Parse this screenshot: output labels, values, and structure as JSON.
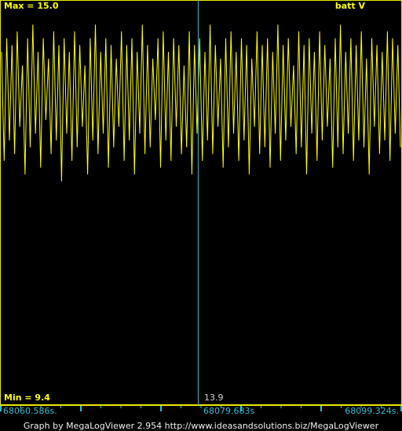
{
  "plot": {
    "max_label": "Max = 15.0",
    "min_label": "Min = 9.4",
    "series_label": "batt V",
    "cursor_value": "13.9"
  },
  "time_axis": {
    "left": "68060.586s.",
    "center": "68079.683s",
    "right": "68099.324s."
  },
  "footer": {
    "credit": "Graph by MegaLogViewer 2.954 http://www.ideasandsolutions.biz/MegaLogViewer"
  },
  "colors": {
    "background": "#000000",
    "trace": "#ffff00",
    "cursor": "#33bbd0",
    "axis_ticks": "#33bbd0",
    "frame": "#e8e800"
  },
  "chart_data": {
    "type": "line",
    "series": [
      {
        "name": "batt V",
        "values": [
          14.4,
          12.8,
          14.6,
          13.1,
          14.5,
          12.9,
          14.7,
          13.3,
          14.2,
          12.6,
          14.6,
          13.0,
          14.8,
          13.2,
          14.4,
          12.7,
          14.6,
          13.4,
          14.3,
          12.9,
          14.7,
          13.1,
          14.5,
          12.5,
          14.6,
          13.2,
          14.4,
          12.8,
          14.7,
          13.0,
          14.5,
          13.3,
          14.2,
          12.6,
          14.6,
          13.1,
          14.8,
          12.9,
          14.4,
          13.2,
          14.6,
          12.7,
          14.5,
          13.0,
          14.3,
          13.3,
          14.7,
          12.8,
          14.5,
          13.1,
          14.6,
          12.6,
          14.4,
          13.2,
          14.8,
          12.9,
          14.5,
          13.0,
          14.3,
          13.4,
          14.6,
          12.7,
          14.7,
          13.1,
          14.4,
          12.8,
          14.6,
          13.3,
          14.5,
          12.9,
          14.2,
          13.0,
          14.7,
          12.6,
          14.5,
          13.2,
          14.6,
          12.8,
          14.4,
          13.1,
          14.8,
          12.9,
          14.5,
          13.3,
          14.3,
          12.7,
          14.6,
          13.0,
          14.7,
          13.2,
          14.4,
          12.8,
          14.6,
          13.1,
          14.5,
          12.6,
          14.3,
          13.3,
          14.7,
          12.9,
          14.5,
          13.0,
          14.6,
          12.7,
          14.4,
          13.2,
          14.8,
          12.8,
          14.5,
          13.1,
          14.6,
          13.3,
          14.2,
          12.9,
          14.7,
          13.0,
          14.5,
          12.6,
          14.6,
          13.2,
          14.4,
          12.8,
          14.7,
          13.1,
          14.5,
          13.3,
          14.3,
          12.7,
          14.6,
          13.0,
          14.8,
          12.9,
          14.4,
          13.2,
          14.6,
          12.8,
          14.5,
          13.1,
          14.7,
          13.0,
          14.3,
          12.6,
          14.6,
          13.3,
          14.5,
          12.9,
          14.4,
          13.1,
          14.7,
          12.8,
          14.6,
          13.2,
          14.5,
          13.0
        ]
      }
    ],
    "x_range": [
      68060.586,
      68099.324
    ],
    "cursor_x": 68079.683,
    "ylim": [
      9.4,
      15.0
    ],
    "grid": false,
    "legend": "top-right"
  }
}
